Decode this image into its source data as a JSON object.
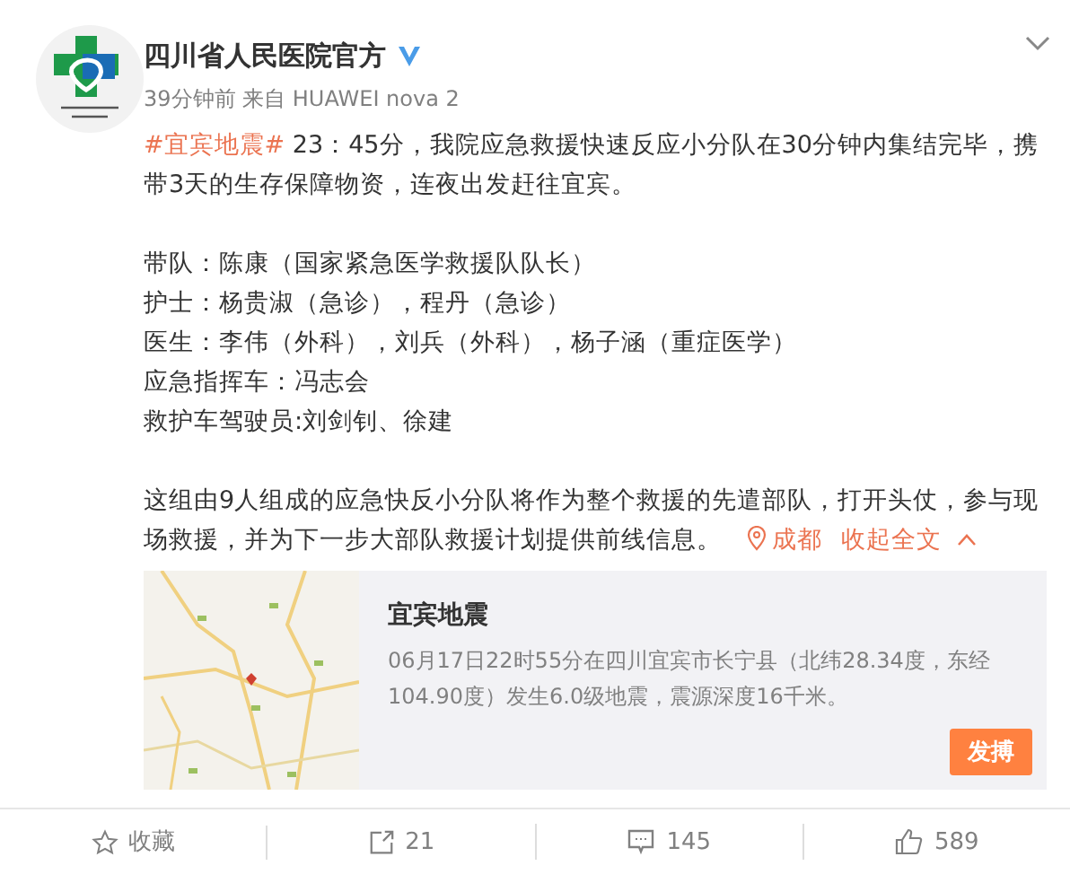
{
  "post": {
    "author": "四川省人民医院官方",
    "verified": true,
    "meta": "39分钟前 来自 HUAWEI nova 2",
    "hashtag": "#宜宾地震#",
    "intro": " 23：45分，我院应急救援快速反应小分队在30分钟内集结完毕，携带3天的生存保障物资，连夜出发赶往宜宾。",
    "lines": [
      "带队：陈康（国家紧急医学救援队队长）",
      "护士：杨贵淑（急诊），程丹（急诊）",
      "医生：李伟（外科），刘兵（外科），杨子涵（重症医学）",
      "应急指挥车：冯志会",
      "救护车驾驶员:刘剑钊、徐建"
    ],
    "closing": "这组由9人组成的应急快反小分队将作为整个救援的先遣部队，打开头仗，参与现场救援，并为下一步大部队救援计划提供前线信息。",
    "location": "成都",
    "collapse": "收起全文"
  },
  "card": {
    "title": "宜宾地震",
    "description": "06月17日22时55分在四川宜宾市长宁县（北纬28.34度，东经104.90度）发生6.0级地震，震源深度16千米。",
    "button": "发搏"
  },
  "actions": [
    {
      "kind": "favorite",
      "label": "收藏"
    },
    {
      "kind": "repost",
      "label": "21"
    },
    {
      "kind": "comment",
      "label": "145"
    },
    {
      "kind": "like",
      "label": "589"
    }
  ]
}
